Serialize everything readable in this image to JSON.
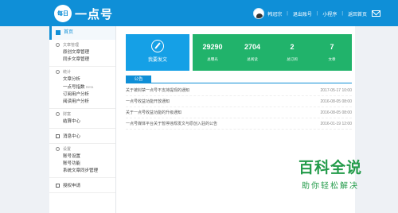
{
  "header": {
    "logo_badge": "每日",
    "logo_text": "一点号",
    "username": "韩冠宗",
    "quit_label": "退出账号",
    "mini_program": "小程序",
    "back_home": "返回首页"
  },
  "sidebar": {
    "home": "首页",
    "groups": [
      {
        "title": "文章管理",
        "items": [
          "原创文章管理",
          "同步文章管理"
        ]
      },
      {
        "title": "统计",
        "items": [
          "文章分析",
          "一点号指数",
          "订阅用户分析",
          "阅读用户分析"
        ],
        "beta": "Beta"
      },
      {
        "title": "财富",
        "items": [
          "结算中心"
        ]
      },
      {
        "title": "设置",
        "items": [
          "账号设置",
          "账号功能",
          "系统文章同步管理"
        ]
      }
    ],
    "message_center": "消息中心",
    "auth_apply": "授权申请"
  },
  "main": {
    "post_label": "我要发文",
    "stats": [
      {
        "value": "29290",
        "label": "总曝光"
      },
      {
        "value": "2704",
        "label": "总阅读"
      },
      {
        "value": "2",
        "label": "总订阅"
      },
      {
        "value": "7",
        "label": "文章"
      }
    ],
    "notice_tag": "公告",
    "notices": [
      {
        "title": "关于被封禁一点号不支持提现的通知",
        "date": "2017-05-17 10:00"
      },
      {
        "title": "一点号收益功能开放通知",
        "date": "2016-08-05 08:00"
      },
      {
        "title": "关于一点号收益功能的升级通知",
        "date": "2016-08-05 08:00"
      },
      {
        "title": "一点号媒体平台关于暂停违规发文与原创入驻的公告",
        "date": "2016-01-19 12:00"
      }
    ]
  },
  "watermark": {
    "big": "百科全说",
    "small": "助你轻松解决"
  }
}
